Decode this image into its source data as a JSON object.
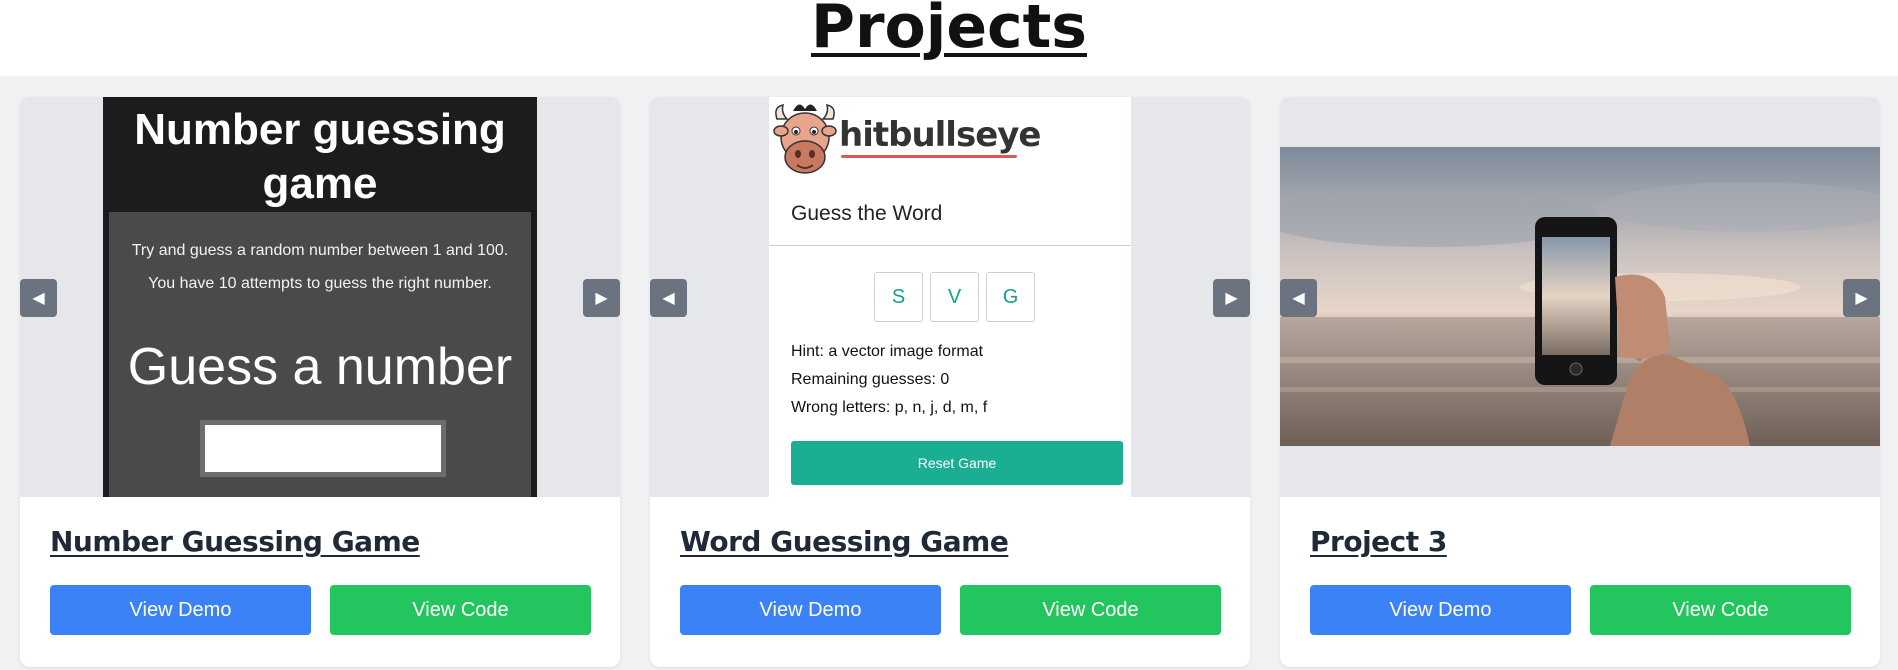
{
  "page": {
    "title": "Projects"
  },
  "projects": [
    {
      "title": "Number Guessing Game",
      "demo_label": "View Demo",
      "code_label": "View Code",
      "preview": {
        "title": "Number guessing game",
        "line1": "Try and guess a random number between 1 and 100.",
        "line2": "You have 10 attempts to guess the right number.",
        "prompt": "Guess a number"
      }
    },
    {
      "title": "Word Guessing Game",
      "demo_label": "View Demo",
      "code_label": "View Code",
      "preview": {
        "brand": "hitbullseye",
        "heading": "Guess the Word",
        "letters": [
          "S",
          "V",
          "G"
        ],
        "hint": "Hint: a vector image format",
        "remaining": "Remaining guesses: 0",
        "wrong": "Wrong letters: p, n, j, d, m, f",
        "reset": "Reset Game"
      }
    },
    {
      "title": "Project 3",
      "demo_label": "View Demo",
      "code_label": "View Code"
    }
  ],
  "carousel": {
    "prev_glyph": "◀",
    "next_glyph": "▶"
  },
  "colors": {
    "demo": "#3b82f6",
    "code": "#22c55e",
    "arrow": "#6b7280",
    "reset": "#1aaf92"
  }
}
